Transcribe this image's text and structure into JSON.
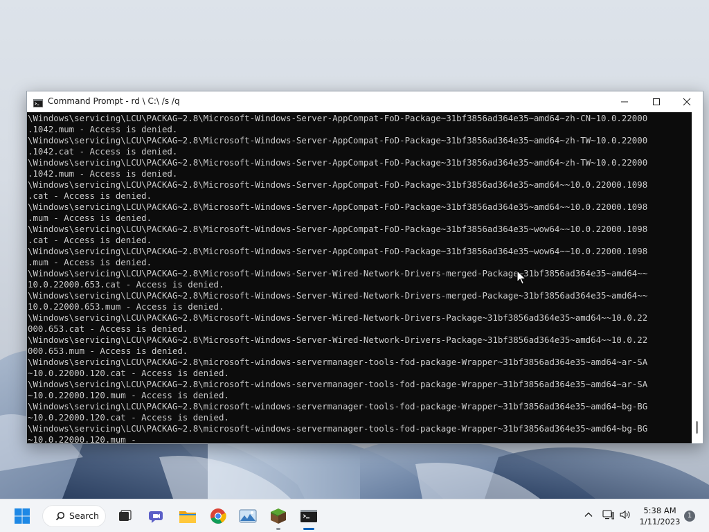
{
  "window": {
    "title": "Command Prompt - rd \\ C:\\ /s /q",
    "controls": {
      "minimize_icon": "minimize-icon",
      "maximize_icon": "maximize-icon",
      "close_icon": "close-icon"
    }
  },
  "console": {
    "background": "#0c0c0c",
    "foreground": "#cccccc",
    "lines": [
      "\\Windows\\servicing\\LCU\\PACKAG~2.8\\Microsoft-Windows-Server-AppCompat-FoD-Package~31bf3856ad364e35~amd64~zh-CN~10.0.22000",
      ".1042.mum - Access is denied.",
      "\\Windows\\servicing\\LCU\\PACKAG~2.8\\Microsoft-Windows-Server-AppCompat-FoD-Package~31bf3856ad364e35~amd64~zh-TW~10.0.22000",
      ".1042.cat - Access is denied.",
      "\\Windows\\servicing\\LCU\\PACKAG~2.8\\Microsoft-Windows-Server-AppCompat-FoD-Package~31bf3856ad364e35~amd64~zh-TW~10.0.22000",
      ".1042.mum - Access is denied.",
      "\\Windows\\servicing\\LCU\\PACKAG~2.8\\Microsoft-Windows-Server-AppCompat-FoD-Package~31bf3856ad364e35~amd64~~10.0.22000.1098",
      ".cat - Access is denied.",
      "\\Windows\\servicing\\LCU\\PACKAG~2.8\\Microsoft-Windows-Server-AppCompat-FoD-Package~31bf3856ad364e35~amd64~~10.0.22000.1098",
      ".mum - Access is denied.",
      "\\Windows\\servicing\\LCU\\PACKAG~2.8\\Microsoft-Windows-Server-AppCompat-FoD-Package~31bf3856ad364e35~wow64~~10.0.22000.1098",
      ".cat - Access is denied.",
      "\\Windows\\servicing\\LCU\\PACKAG~2.8\\Microsoft-Windows-Server-AppCompat-FoD-Package~31bf3856ad364e35~wow64~~10.0.22000.1098",
      ".mum - Access is denied.",
      "\\Windows\\servicing\\LCU\\PACKAG~2.8\\Microsoft-Windows-Server-Wired-Network-Drivers-merged-Package~31bf3856ad364e35~amd64~~",
      "10.0.22000.653.cat - Access is denied.",
      "\\Windows\\servicing\\LCU\\PACKAG~2.8\\Microsoft-Windows-Server-Wired-Network-Drivers-merged-Package~31bf3856ad364e35~amd64~~",
      "10.0.22000.653.mum - Access is denied.",
      "\\Windows\\servicing\\LCU\\PACKAG~2.8\\Microsoft-Windows-Server-Wired-Network-Drivers-Package~31bf3856ad364e35~amd64~~10.0.22",
      "000.653.cat - Access is denied.",
      "\\Windows\\servicing\\LCU\\PACKAG~2.8\\Microsoft-Windows-Server-Wired-Network-Drivers-Package~31bf3856ad364e35~amd64~~10.0.22",
      "000.653.mum - Access is denied.",
      "\\Windows\\servicing\\LCU\\PACKAG~2.8\\microsoft-windows-servermanager-tools-fod-package-Wrapper~31bf3856ad364e35~amd64~ar-SA",
      "~10.0.22000.120.cat - Access is denied.",
      "\\Windows\\servicing\\LCU\\PACKAG~2.8\\microsoft-windows-servermanager-tools-fod-package-Wrapper~31bf3856ad364e35~amd64~ar-SA",
      "~10.0.22000.120.mum - Access is denied.",
      "\\Windows\\servicing\\LCU\\PACKAG~2.8\\microsoft-windows-servermanager-tools-fod-package-Wrapper~31bf3856ad364e35~amd64~bg-BG",
      "~10.0.22000.120.cat - Access is denied.",
      "\\Windows\\servicing\\LCU\\PACKAG~2.8\\microsoft-windows-servermanager-tools-fod-package-Wrapper~31bf3856ad364e35~amd64~bg-BG",
      "~10.0.22000.120.mum - "
    ]
  },
  "taskbar": {
    "start_icon": "windows-start-icon",
    "search_label": "Search",
    "apps": [
      {
        "name": "task-view",
        "icon": "task-view-icon"
      },
      {
        "name": "teams-chat",
        "icon": "teams-chat-icon"
      },
      {
        "name": "file-explorer",
        "icon": "folder-icon"
      },
      {
        "name": "chrome",
        "icon": "chrome-icon"
      },
      {
        "name": "photos",
        "icon": "photo-icon"
      },
      {
        "name": "minecraft",
        "icon": "minecraft-icon"
      },
      {
        "name": "command-prompt",
        "icon": "terminal-icon",
        "active": true
      }
    ],
    "tray": {
      "chevron_icon": "chevron-up-icon",
      "network_icon": "network-icon",
      "volume_icon": "volume-icon",
      "time": "5:38 AM",
      "date": "1/11/2023",
      "notification_count": "1"
    }
  }
}
